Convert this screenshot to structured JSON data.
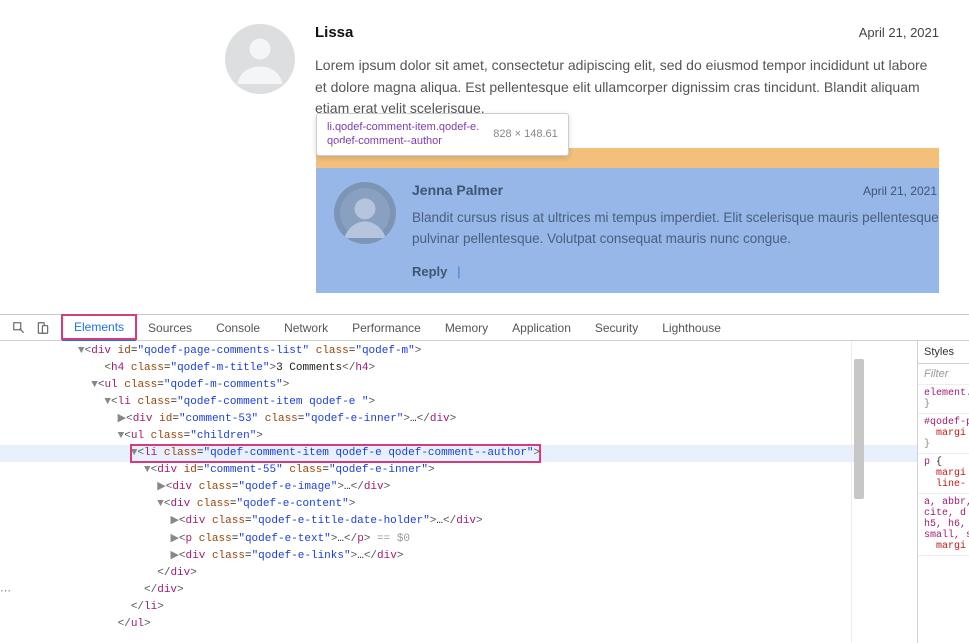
{
  "comment1": {
    "author": "Lissa",
    "date": "April 21, 2021",
    "body": "Lorem ipsum dolor sit amet, consectetur adipiscing elit, sed do eiusmod tempor incididunt ut labore et dolore magna aliqua. Est pellentesque elit ullamcorper dignissim cras tincidunt. Blandit aliquam etiam erat velit scelerisque."
  },
  "tooltip": {
    "selector_line1": "li.qodef-comment-item.qodef-e.",
    "selector_line2": "qodef-comment--author",
    "dims": "828 × 148.61"
  },
  "comment2": {
    "author": "Jenna Palmer",
    "date": "April 21, 2021",
    "body": "Blandit cursus risus at ultrices mi tempus imperdiet. Elit scelerisque mauris pellentesque pulvinar pellentesque. Volutpat consequat mauris nunc congue.",
    "reply": "Reply"
  },
  "devtools": {
    "tabs": [
      "Elements",
      "Sources",
      "Console",
      "Network",
      "Performance",
      "Memory",
      "Application",
      "Security",
      "Lighthouse"
    ],
    "styles_tab": "Styles",
    "filter_placeholder": "Filter",
    "rules": [
      {
        "sel": "element.",
        "body": "{\n}"
      },
      {
        "sel": "#qodef-p",
        "body": "{\n    margi"
      },
      {
        "sel": "p",
        "body": "{\n    margi\n    line-"
      },
      {
        "sel": "a, abbr,\ncite, d\nh5, h6,\nsmall, s\n    margi"
      }
    ]
  },
  "code": {
    "comments_title": "3 Comments",
    "eq": "== $0"
  }
}
